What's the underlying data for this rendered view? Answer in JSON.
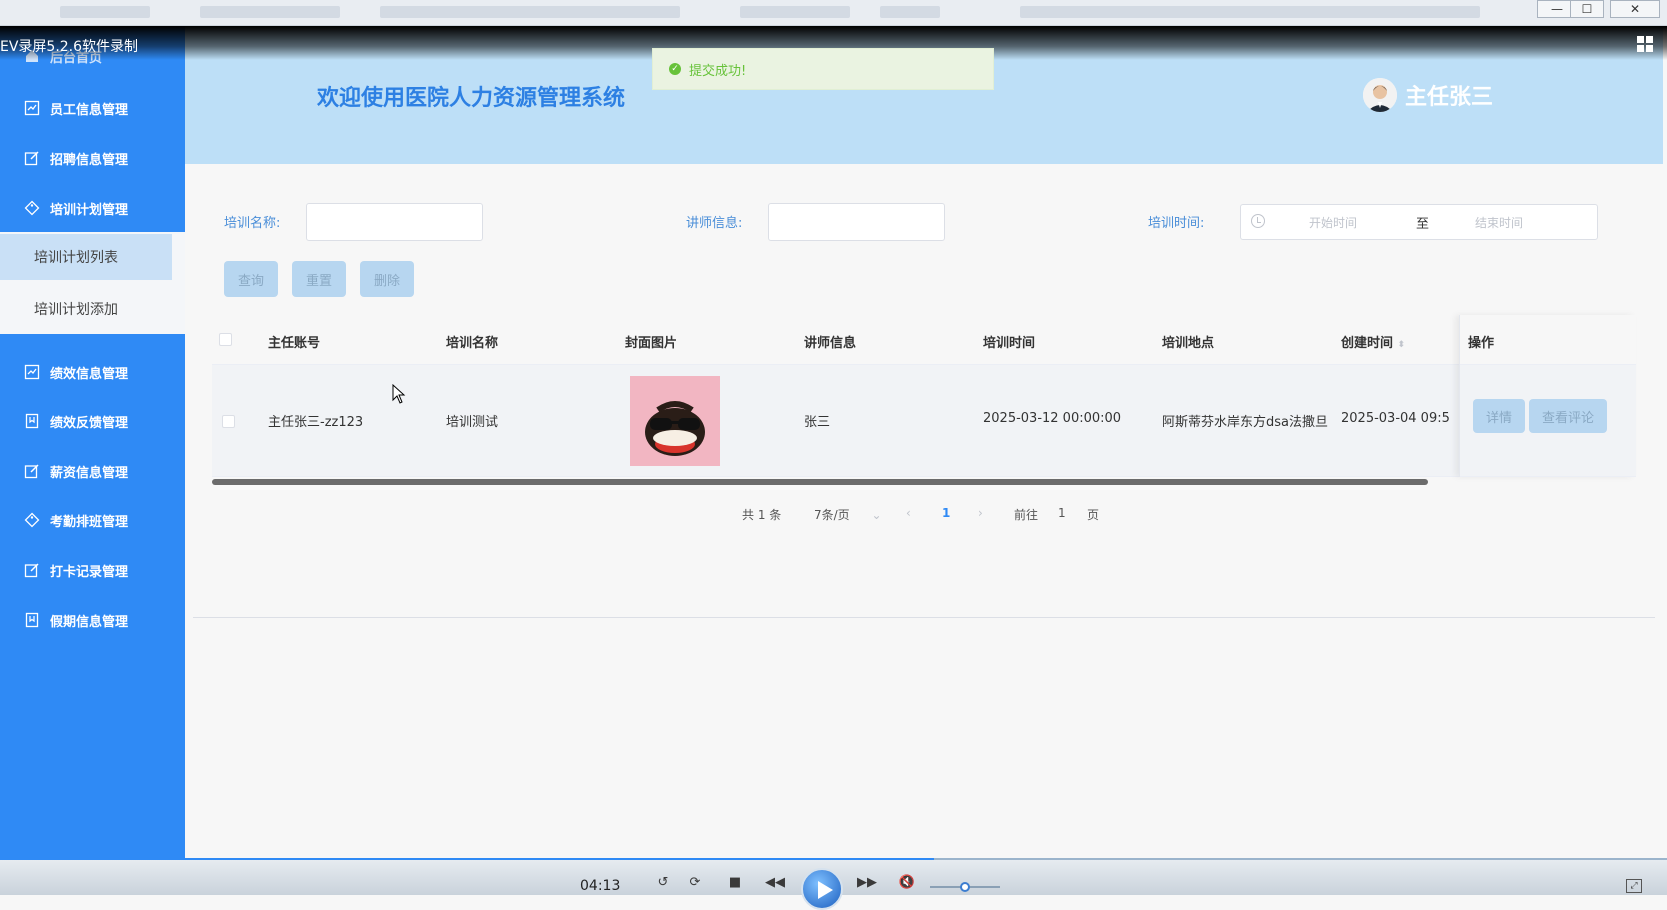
{
  "recorder": {
    "title": "EV录屏5.2.6软件录制",
    "timecode": "04:13",
    "progress_fraction": 0.56
  },
  "sidebar": {
    "home_label": "后台首页",
    "items": [
      {
        "label": "员工信息管理",
        "icon": "chart-icon"
      },
      {
        "label": "招聘信息管理",
        "icon": "edit-icon"
      },
      {
        "label": "培训计划管理",
        "icon": "tag-icon"
      },
      {
        "label": "绩效信息管理",
        "icon": "chart-icon"
      },
      {
        "label": "绩效反馈管理",
        "icon": "bookmark-icon"
      },
      {
        "label": "薪资信息管理",
        "icon": "edit-icon"
      },
      {
        "label": "考勤排班管理",
        "icon": "tag-icon"
      },
      {
        "label": "打卡记录管理",
        "icon": "edit-icon"
      },
      {
        "label": "假期信息管理",
        "icon": "bookmark-icon"
      }
    ],
    "submenu": [
      {
        "label": "培训计划列表",
        "active": true
      },
      {
        "label": "培训计划添加",
        "active": false
      }
    ]
  },
  "header": {
    "welcome": "欢迎使用医院人力资源管理系统",
    "user_name": "主任张三"
  },
  "toast": {
    "message": "提交成功!"
  },
  "search": {
    "name_label": "培训名称:",
    "teacher_label": "讲师信息:",
    "time_label": "培训时间:",
    "start_placeholder": "开始时间",
    "range_separator": "至",
    "end_placeholder": "结束时间"
  },
  "buttons": {
    "query": "查询",
    "reset": "重置",
    "delete": "删除"
  },
  "table": {
    "headers": [
      "主任账号",
      "培训名称",
      "封面图片",
      "讲师信息",
      "培训时间",
      "培训地点",
      "创建时间",
      "操作"
    ],
    "rows": [
      {
        "account": "主任张三-zz123",
        "name": "培训测试",
        "teacher": "张三",
        "time": "2025-03-12 00:00:00",
        "location": "阿斯蒂芬水岸东方dsa法撒旦",
        "created": "2025-03-04 09:5",
        "actions": [
          "详情",
          "查看评论"
        ]
      }
    ]
  },
  "pagination": {
    "total": "共 1 条",
    "page_size": "7条/页",
    "current_page": "1",
    "goto_label": "前往",
    "goto_value": "1",
    "page_unit": "页"
  },
  "colors": {
    "sidebar": "#2f8af5",
    "header": "#bddff7",
    "accent": "#2d80e3",
    "button": "#b7d6f0"
  }
}
